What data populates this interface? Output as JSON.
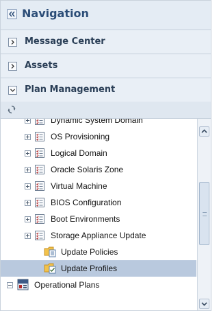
{
  "navigation": {
    "title": "Navigation"
  },
  "sections": {
    "message_center": "Message Center",
    "assets": "Assets",
    "plan_management": "Plan Management"
  },
  "tree": {
    "items": [
      {
        "label": "Dynamic System Domain",
        "icon": "checklist-icon"
      },
      {
        "label": "OS Provisioning",
        "icon": "checklist-icon"
      },
      {
        "label": "Logical Domain",
        "icon": "checklist-icon"
      },
      {
        "label": "Oracle Solaris Zone",
        "icon": "checklist-icon"
      },
      {
        "label": "Virtual Machine",
        "icon": "checklist-icon"
      },
      {
        "label": "BIOS Configuration",
        "icon": "checklist-icon"
      },
      {
        "label": "Boot Environments",
        "icon": "checklist-icon"
      },
      {
        "label": "Storage Appliance Update",
        "icon": "checklist-icon"
      },
      {
        "label": "Update Policies",
        "icon": "folder-policy-icon"
      },
      {
        "label": "Update Profiles",
        "icon": "folder-profile-icon",
        "selected": true
      },
      {
        "label": "Operational Plans",
        "icon": "op-plan-icon"
      }
    ]
  },
  "colors": {
    "selection": "#b9c9de",
    "header_bg": "#e4ecf4",
    "title": "#2b4d77"
  }
}
